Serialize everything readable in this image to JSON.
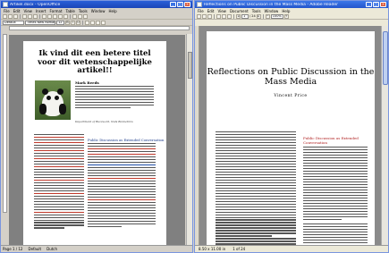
{
  "left_window": {
    "title": "Artikel.docx - OpenOffice",
    "menu": [
      "File",
      "Edit",
      "View",
      "Insert",
      "Format",
      "Table",
      "Tools",
      "Window",
      "Help"
    ],
    "toolbar": {
      "style": "Default",
      "font": "Times New Roman",
      "size": "12"
    },
    "document": {
      "title": "Ik vind dit een betere titel voor dit wetenschappelijke artikel!!",
      "author": "Mark Reeds",
      "affiliation": "Department of Buzzword, Nuts Biometrics",
      "section": "Public Discussion as Extended Conversation"
    },
    "status": {
      "page": "Page 1 / 12",
      "style": "Default",
      "lang": "Dutch"
    }
  },
  "right_window": {
    "title": "Reflections on Public Discussion in the Mass Media - Adobe Reader",
    "menu": [
      "File",
      "Edit",
      "View",
      "Document",
      "Tools",
      "Window",
      "Help"
    ],
    "toolbar": {
      "page": "1",
      "of": "/ 24",
      "zoom": "100%"
    },
    "document": {
      "title": "Reflections on Public Discussion in the Mass Media",
      "author": "Vincent Price",
      "section": "Public Discussion as Extended Conversation"
    },
    "status": {
      "size": "8.50 x 11.00 in",
      "pages": "1 of 24"
    }
  },
  "colors": {
    "titlebar": "#1a45b8",
    "section_red": "#b02020",
    "section_blue": "#1a3a8a"
  }
}
